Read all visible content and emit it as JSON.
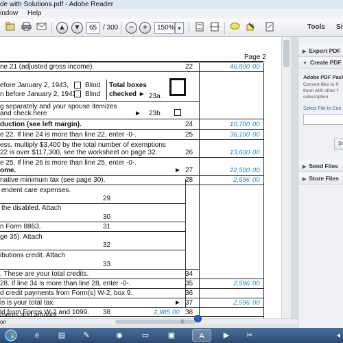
{
  "window": {
    "title": "de with Solutions.pdf - Adobe Reader"
  },
  "menu": [
    "indow",
    "Help"
  ],
  "toolbar": {
    "page_current": "65",
    "page_total": "/ 300",
    "zoom": "150%",
    "tools": "Tools",
    "sign": "Si"
  },
  "form": {
    "page": "Page 2",
    "rows": [
      {
        "text": "ne 21 (adjusted gross income).",
        "num": "22",
        "amt": "46,800",
        "cts": "00"
      },
      {
        "text": "efore January 2, 1943,",
        "sub": "Blind"
      },
      {
        "text": "n before January 2, 1943,",
        "sub": "Blind",
        "total": "Total boxes",
        "checked": "checked ►",
        "line": "23a"
      },
      {
        "text": "g separately and your spouse itemizes"
      },
      {
        "text": "and check here",
        "arrow": "►",
        "line": "23b"
      },
      {
        "text": "duction (see left margin).",
        "num": "24",
        "amt": "10,700",
        "cts": "00"
      },
      {
        "text": "e 22. If line 24 is more than line 22, enter -0-.",
        "num": "25",
        "amt": "36,100",
        "cts": "00"
      },
      {
        "text": "ess, multiply $3,400 by the total number of exemptions"
      },
      {
        "text": "22 is over $117,300, see the worksheet on page 32.",
        "num": "26",
        "amt": "13,600",
        "cts": "00"
      },
      {
        "text": "e 25. If line 26 is more than line 25, enter -0-."
      },
      {
        "text": "ome.",
        "num": "27",
        "amt": "22,500",
        "cts": "00"
      },
      {
        "text": "native minimum tax (see page 30).",
        "num": "28",
        "amt": "2,596",
        "cts": "00"
      },
      {
        "text": "endent care expenses."
      },
      {
        "text": "",
        "inner": "29"
      },
      {
        "text": "the disabled. Attach"
      },
      {
        "text": "",
        "inner": "30"
      },
      {
        "text": "n Form 8863.",
        "inner": "31"
      },
      {
        "text": "ge 35). Attach"
      },
      {
        "text": "",
        "inner": "32"
      },
      {
        "text": "ibutions credit. Attach"
      },
      {
        "text": "",
        "inner": "33"
      },
      {
        "text": ". These are your total credits.",
        "num": "34"
      },
      {
        "text": "28. If line 34 is more than line 28, enter -0-.",
        "num": "35",
        "amt": "2,596",
        "cts": "00"
      },
      {
        "text": "d credit payments from Form(s) W-2, box 9.",
        "num": "36"
      },
      {
        "text": "is is your total tax.",
        "num": "37",
        "amt": "2,596",
        "cts": "00"
      },
      {
        "text": "ld from Forms W-2 and 1099.",
        "inner": "38",
        "inner_amt": "2,985",
        "inner_cts": "00",
        "num": "38"
      },
      {
        "text": "ments and amount"
      },
      {
        "text": "on"
      }
    ]
  },
  "right_pane": {
    "export": "Export PDF",
    "create": "Create PDF",
    "title": "Adobe PDF Pack",
    "body": [
      "Convert files to P",
      "them with other f",
      "subscription."
    ],
    "select": "Select File to Con",
    "button": "Se",
    "send": "Send Files",
    "store": "Store Files"
  },
  "icons": [
    "save-icon",
    "print-icon",
    "email-icon",
    "page-up-icon",
    "page-down-icon",
    "zoom-out-icon",
    "zoom-in-icon",
    "fit-page-icon",
    "fit-width-icon",
    "comment-icon",
    "highlight-icon",
    "sign-icon"
  ],
  "colors": {
    "form_values": "#1b86c4",
    "toolbar_bg": "#e5e8ed"
  }
}
